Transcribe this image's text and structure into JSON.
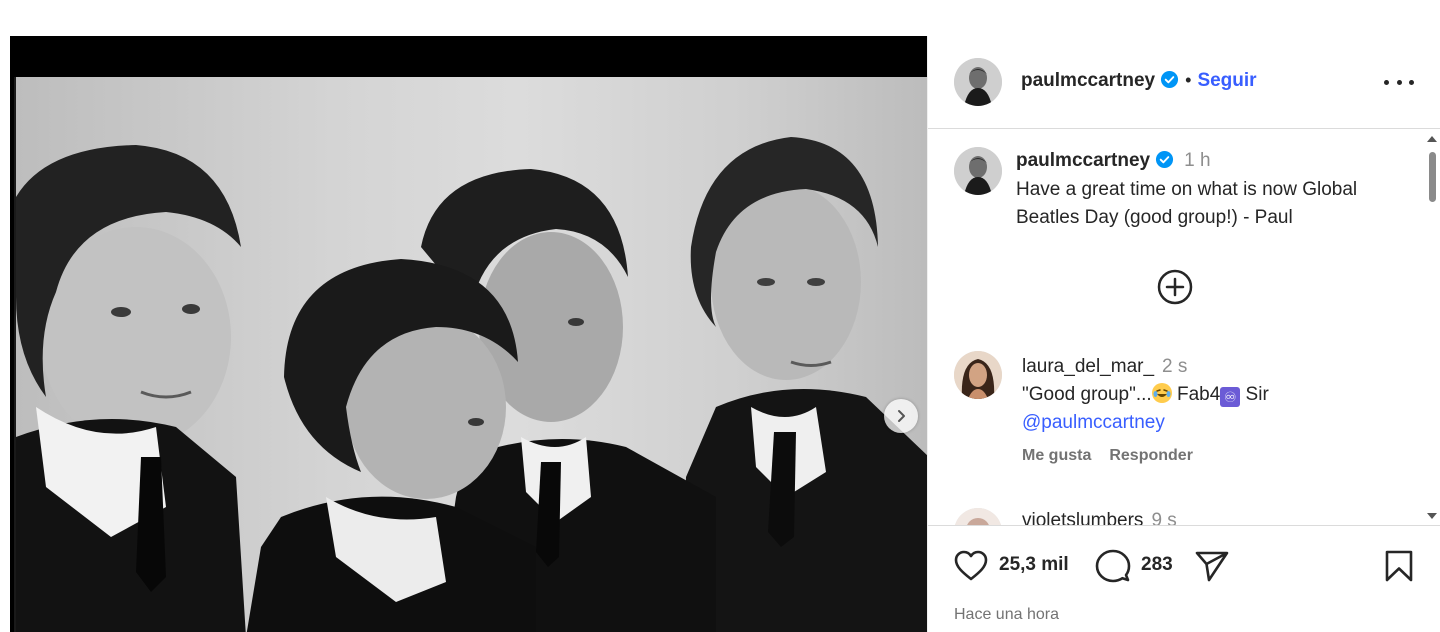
{
  "post": {
    "author": "paulmccartney",
    "follow_label": "Seguir",
    "separator": "•",
    "caption": {
      "author": "paulmccartney",
      "time": "1 h",
      "text_line1": "Have a great time on what is now Global",
      "text_line2": "Beatles Day (good group!) - Paul"
    },
    "comments": [
      {
        "author": "laura_del_mar_",
        "time": "2 s",
        "text_start": "\"Good group\"...",
        "text_mid": " Fab4",
        "text_end": " Sir",
        "mention": "@paulmccartney",
        "like_label": "Me gusta",
        "reply_label": "Responder"
      },
      {
        "author": "violetslumbers",
        "time": "9 s"
      }
    ],
    "likes": "25,3 mil",
    "comment_count": "283",
    "posted_ago": "Hace una hora"
  },
  "icons": {
    "verified": "verified-badge-icon",
    "more": "more-options-icon",
    "load_more": "plus-circle-icon",
    "like": "heart-icon",
    "comment": "comment-icon",
    "share": "share-icon",
    "save": "bookmark-icon",
    "next": "chevron-right-icon",
    "infinity_glyph": "♾"
  },
  "colors": {
    "accent": "#385eff",
    "verified": "#0095f6",
    "muted": "#737373"
  }
}
